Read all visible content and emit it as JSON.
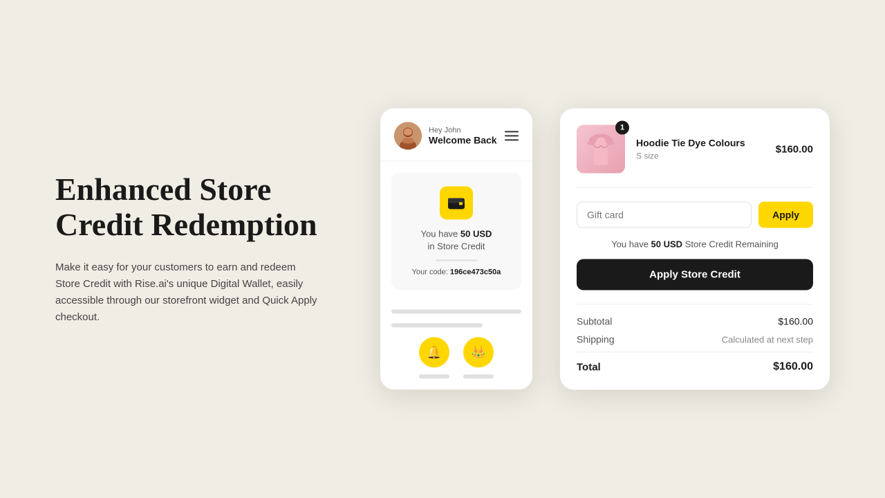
{
  "page": {
    "background_color": "#f0ede4"
  },
  "left": {
    "title_line1": "Enhanced Store",
    "title_line2": "Credit Redemption",
    "description": "Make it easy for your customers to earn and redeem Store Credit with Rise.ai's unique Digital Wallet, easily accessible through our storefront widget and Quick Apply checkout."
  },
  "mobile_widget": {
    "greeting_hey": "Hey John",
    "greeting_name": "Welcome Back",
    "credit_text_prefix": "You have ",
    "credit_amount": "50 USD",
    "credit_text_suffix": "in Store Credit",
    "code_label": "Your code:",
    "code_value": "196ce473c50a",
    "wallet_icon": "💳",
    "bell_icon": "🔔",
    "crown_icon": "👑",
    "avatar_emoji": "🧔"
  },
  "checkout": {
    "product_name": "Hoodie Tie Dye Colours",
    "product_variant": "S size",
    "product_price": "$160.00",
    "product_badge": "1",
    "product_emoji": "🧥",
    "gift_card_placeholder": "Gift card",
    "apply_button_label": "Apply",
    "store_credit_info_prefix": "You have ",
    "store_credit_amount": "50 USD",
    "store_credit_info_suffix": " Store Credit Remaining",
    "apply_store_credit_label": "Apply Store Credit",
    "subtotal_label": "Subtotal",
    "subtotal_value": "$160.00",
    "shipping_label": "Shipping",
    "shipping_value": "Calculated at next step",
    "total_label": "Total",
    "total_value": "$160.00"
  }
}
